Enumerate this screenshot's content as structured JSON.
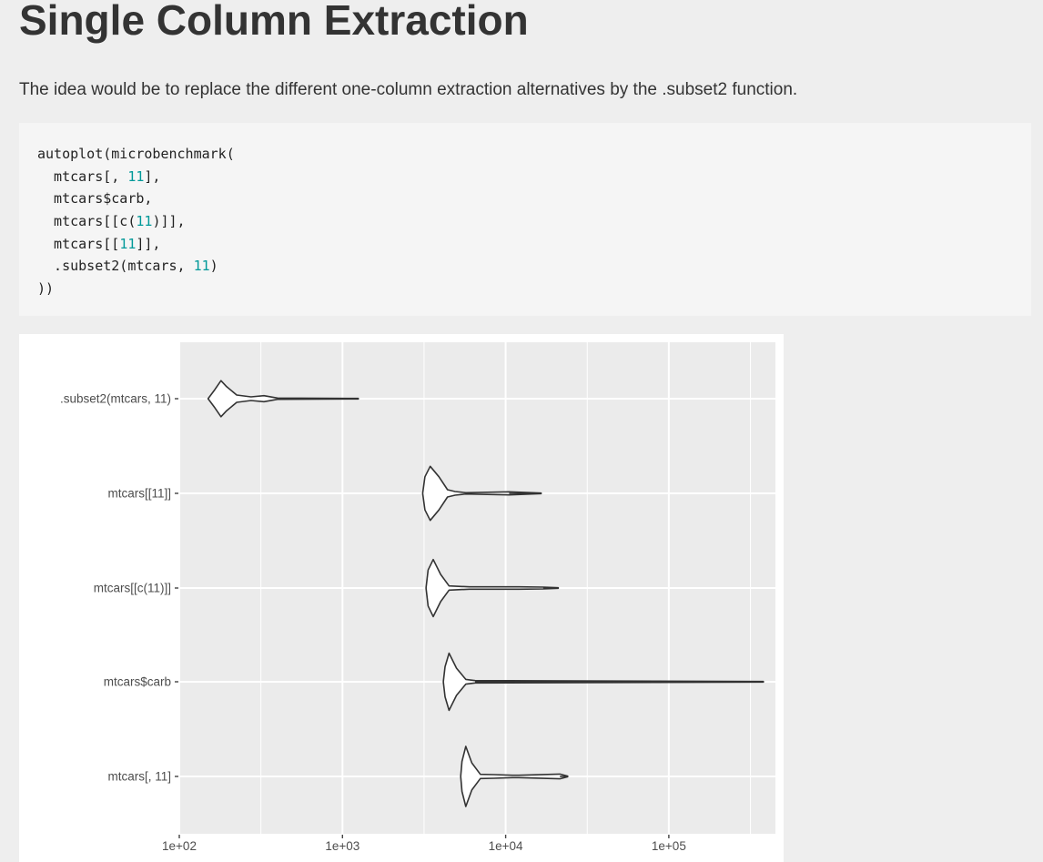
{
  "heading": "Single Column Extraction",
  "intro": "The idea would be to replace the different one-column extraction alternatives by the .subset2 function.",
  "code": {
    "lines": [
      [
        {
          "t": "autoplot(microbenchmark("
        }
      ],
      [
        {
          "t": "  mtcars[, "
        },
        {
          "t": "11",
          "num": true
        },
        {
          "t": "],"
        }
      ],
      [
        {
          "t": "  mtcars$carb,"
        }
      ],
      [
        {
          "t": "  mtcars[[c("
        },
        {
          "t": "11",
          "num": true
        },
        {
          "t": ")]],"
        }
      ],
      [
        {
          "t": "  mtcars[["
        },
        {
          "t": "11",
          "num": true
        },
        {
          "t": "]],"
        }
      ],
      [
        {
          "t": "  .subset2(mtcars, "
        },
        {
          "t": "11",
          "num": true
        },
        {
          "t": ")"
        }
      ],
      [
        {
          "t": "))"
        }
      ]
    ],
    "number_color": "#009999"
  },
  "chart_data": {
    "type": "violin",
    "orientation": "horizontal",
    "x_scale": "log10",
    "xlim": [
      100,
      450000
    ],
    "x_ticks": [
      {
        "value": 100,
        "label": "1e+02"
      },
      {
        "value": 1000,
        "label": "1e+03"
      },
      {
        "value": 10000,
        "label": "1e+04"
      },
      {
        "value": 100000,
        "label": "1e+05"
      }
    ],
    "categories": [
      ".subset2(mtcars, 11)",
      "mtcars[[11]]",
      "mtcars[[c(11)]]",
      "mtcars$carb",
      "mtcars[, 11]"
    ],
    "series": [
      {
        "category": ".subset2(mtcars, 11)",
        "min": 150,
        "max": 1250,
        "bulbs": [
          [
            150,
            0
          ],
          [
            165,
            0.3
          ],
          [
            180,
            0.6
          ],
          [
            195,
            0.4
          ],
          [
            225,
            0.12
          ],
          [
            275,
            0.06
          ],
          [
            330,
            0.1
          ],
          [
            400,
            0.02
          ],
          [
            1250,
            0.01
          ]
        ]
      },
      {
        "category": "mtcars[[11]]",
        "min": 3100,
        "max": 16500,
        "bulbs": [
          [
            3100,
            0
          ],
          [
            3200,
            0.55
          ],
          [
            3450,
            0.9
          ],
          [
            3900,
            0.55
          ],
          [
            4400,
            0.12
          ],
          [
            4900,
            0.06
          ],
          [
            5700,
            0.02
          ],
          [
            10500,
            0.05
          ],
          [
            16500,
            0.01
          ]
        ]
      },
      {
        "category": "mtcars[[c(11)]]",
        "min": 3250,
        "max": 21000,
        "bulbs": [
          [
            3250,
            0
          ],
          [
            3350,
            0.6
          ],
          [
            3600,
            0.95
          ],
          [
            4000,
            0.45
          ],
          [
            4500,
            0.07
          ],
          [
            6000,
            0.04
          ],
          [
            12000,
            0.04
          ],
          [
            17000,
            0.03
          ],
          [
            21000,
            0.01
          ]
        ]
      },
      {
        "category": "mtcars$carb",
        "min": 4150,
        "max": 380000,
        "bulbs": [
          [
            4150,
            0
          ],
          [
            4250,
            0.5
          ],
          [
            4500,
            0.95
          ],
          [
            5000,
            0.45
          ],
          [
            5700,
            0.08
          ],
          [
            6500,
            0.04
          ],
          [
            380000,
            0.01
          ]
        ]
      },
      {
        "category": "mtcars[, 11]",
        "min": 5300,
        "max": 24000,
        "bulbs": [
          [
            5300,
            0
          ],
          [
            5400,
            0.5
          ],
          [
            5700,
            1.0
          ],
          [
            6200,
            0.45
          ],
          [
            7000,
            0.07
          ],
          [
            8500,
            0.06
          ],
          [
            11000,
            0.04
          ],
          [
            12000,
            0.04
          ],
          [
            21500,
            0.08
          ],
          [
            24000,
            0.01
          ]
        ]
      }
    ],
    "panel_color": "#ebebeb",
    "grid_color": "#ffffff",
    "line_color": "#333333"
  }
}
